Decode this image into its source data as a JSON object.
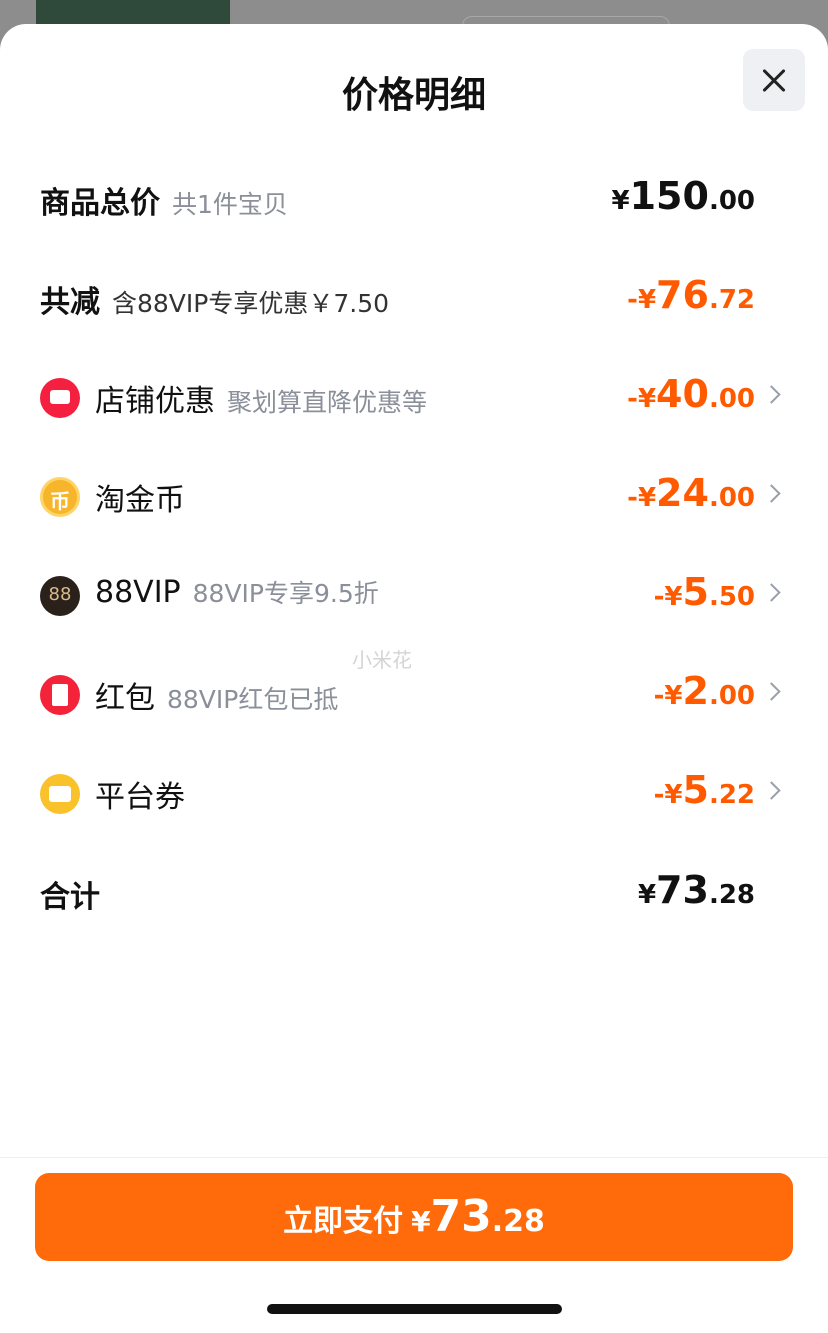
{
  "title": "价格明细",
  "rows": {
    "total": {
      "label": "商品总价",
      "sub": "共1件宝贝",
      "sign": "¥",
      "int": "150",
      "dec": ".00"
    },
    "reduce": {
      "label": "共减",
      "sub": "含88VIP专享优惠￥7.50",
      "sign": "-¥",
      "int": "76",
      "dec": ".72"
    },
    "store": {
      "label": "店铺优惠",
      "sub": "聚划算直降优惠等",
      "sign": "-¥",
      "int": "40",
      "dec": ".00"
    },
    "coin": {
      "label": "淘金币",
      "icon_text": "币",
      "sign": "-¥",
      "int": "24",
      "dec": ".00"
    },
    "vip": {
      "label": "88VIP",
      "icon_text": "88",
      "sub": "88VIP专享9.5折",
      "sign": "-¥",
      "int": "5",
      "dec": ".50"
    },
    "hongbao": {
      "label": "红包",
      "sub": "88VIP红包已抵",
      "sign": "-¥",
      "int": "2",
      "dec": ".00"
    },
    "coupon": {
      "label": "平台券",
      "sign": "-¥",
      "int": "5",
      "dec": ".22"
    },
    "sum": {
      "label": "合计",
      "sign": "¥",
      "int": "73",
      "dec": ".28"
    }
  },
  "watermark": "小米花",
  "pay": {
    "label": "立即支付",
    "sign": "¥",
    "int": "73",
    "dec": ".28"
  },
  "colors": {
    "accent": "#ff6a0a",
    "discount": "#ff5a00"
  }
}
